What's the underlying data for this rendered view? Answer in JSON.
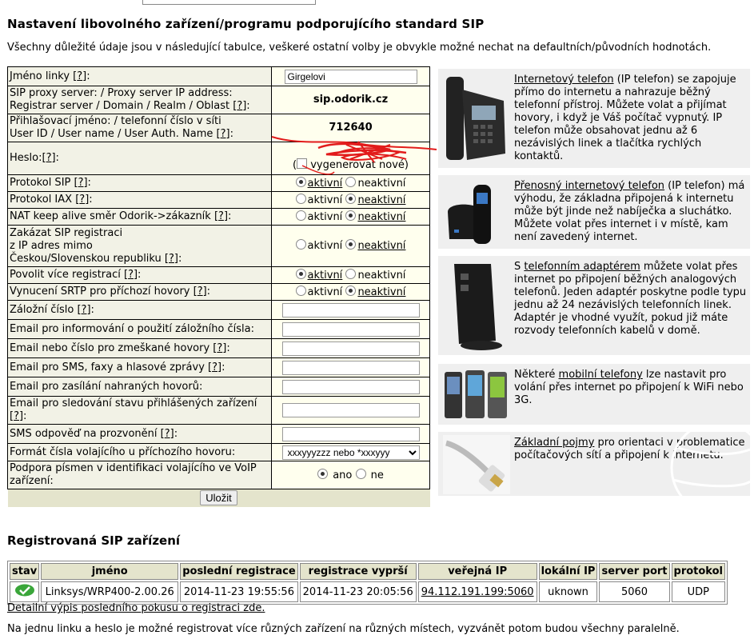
{
  "heading": "Nastavení libovolného zařízení/programu podporujícího standard SIP",
  "intro": "Všechny důležité údaje jsou v následující tabulce, veškeré ostatní volby je obvykle možné nechat na defaultních/původních hodnotách.",
  "help": "?",
  "rows": {
    "line_name": {
      "label": "Jméno linky [",
      "value": "Girgelovi"
    },
    "proxy": {
      "label1": "SIP proxy server: / Proxy server IP address:",
      "label2": "Registrar server / Domain / Realm / Oblast [",
      "value": "sip.odorik.cz"
    },
    "login": {
      "label1": "Přihlašovací jméno: / telefonní číslo v síti",
      "label2": "User ID / User name / User Auth. Name [",
      "value": "712640"
    },
    "password": {
      "label": "Heslo:[",
      "generate": "vygenerovat nové"
    },
    "sip": {
      "label": "Protokol SIP ["
    },
    "iax": {
      "label": "Protokol IAX ["
    },
    "nat": {
      "label": "NAT keep alive směr Odorik->zákazník ["
    },
    "block": {
      "label1": "Zakázat SIP registraci",
      "label2": "z IP adres mimo",
      "label3": "Českou/Slovenskou republiku ["
    },
    "multi": {
      "label": "Povolit více registrací ["
    },
    "srtp": {
      "label": "Vynucení SRTP pro příchozí hovory ["
    },
    "backup": {
      "label": "Záložní číslo ["
    },
    "email_backup": {
      "label": "Email pro informování o použití záložního čísla:"
    },
    "email_missed": {
      "label": "Email nebo číslo pro zmeškané hovory ["
    },
    "email_sms": {
      "label": "Email pro SMS, faxy a hlasové zprávy ["
    },
    "email_rec": {
      "label": "Email pro zasílání nahraných hovorů:"
    },
    "email_status": {
      "label1": "Email pro sledování stavu přihlášených zařízení",
      "label2": "["
    },
    "sms_reply": {
      "label": "SMS odpověď na prozvonění ["
    },
    "format": {
      "label": "Formát čísla volajícího u příchozího hovoru:",
      "selected": "xxxyyyzzz nebo *xxxyyy"
    },
    "letters": {
      "label1": "Podpora písmen v identifikaci volajícího ve VoIP",
      "label2": "zařízení:",
      "yes": "ano",
      "no": "ne"
    }
  },
  "active": "aktivní",
  "inactive": "neaktivní",
  "save_label": "Uložit",
  "cards": [
    {
      "link": "Internetový telefon",
      "rest": " (IP telefon) se zapojuje přímo do internetu a nahrazuje běžný telefonní přístroj. Můžete volat a přijímat hovory, i když je Váš počítač vypnutý. IP telefon může obsahovat jednu až 6 nezávislých linek a tlačítka rychlých kontaktů."
    },
    {
      "link": "Přenosný internetový telefon",
      "rest": " (IP telefon) má výhodu, že základna připojená k internetu může být jinde než nabíječka a sluchátko. Můžete volat přes internet i v místě, kam není zavedený internet."
    },
    {
      "pre": "S ",
      "link": "telefonním adaptérem",
      "rest": " můžete volat přes internet po připojení běžných analogových telefonů. Jeden adaptér poskytne podle typu jednu až 24 nezávislých telefonních linek. Adaptér je vhodné využít, pokud již máte rozvody telefonních kabelů v domě."
    },
    {
      "pre": "Některé ",
      "link": "mobilní telefony",
      "rest": " lze nastavit pro volání přes internet po připojení k WiFi nebo 3G."
    },
    {
      "link": "Základní pojmy",
      "rest": " pro orientaci v problematice počítačových sítí a připojení k internetu."
    }
  ],
  "registered": {
    "title": "Registrovaná SIP zařízení",
    "headers": [
      "stav",
      "jméno",
      "poslední registrace",
      "registrace vyprší",
      "veřejná IP",
      "lokální IP",
      "server port",
      "protokol"
    ],
    "row": {
      "name": "Linksys/WRP400-2.00.26",
      "last": "2014-11-23 19:55:56",
      "expires": "2014-11-23 20:05:56",
      "ip": "94.112.191.199:5060",
      "local_ip": "uknown",
      "port": "5060",
      "protocol": "UDP"
    },
    "detail_link": "Detailní výpis posledního pokusu o registraci zde.",
    "bottom": "Na jednu linku a heslo je možné registrovat více různých zařízení na různých místech, vyzvánět potom budou všechny paralelně."
  },
  "colors": {
    "label_bg": "#f2f2e6",
    "value_bg": "#ffffee",
    "card_bg": "#efefef",
    "scribble": "#e21b1b",
    "status_green": "#3aa63a"
  }
}
